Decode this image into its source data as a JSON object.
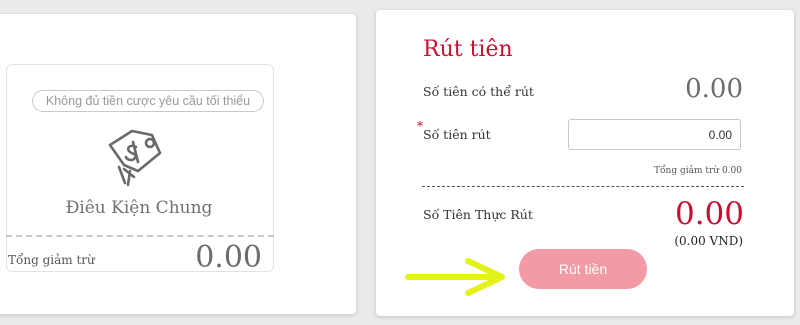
{
  "left_card": {
    "badge": "Không đủ tiền cược yêu cầu tối thiểu",
    "title": "Điêu Kiện Chung",
    "total_deduct_label": "Tổng giảm trừ",
    "total_deduct_value": "0.00",
    "icon": "price-tag-icon"
  },
  "withdraw": {
    "title": "Rút tiên",
    "available_label": "Số tiên có thể rút",
    "available_value": "0.00",
    "required_mark": "*",
    "amount_label": "Số tiên rút",
    "amount_value": "0.00",
    "total_deduct": "Tổng giảm trừ 0.00",
    "actual_label": "Số Tiên Thực Rút",
    "actual_value": "0.00",
    "actual_vnd": "(0.00 VND)",
    "button_label": "Rút tiền"
  },
  "colors": {
    "accent_red": "#c8102e",
    "button_pink": "#f29aa6",
    "arrow_yellow": "#e3f218"
  }
}
